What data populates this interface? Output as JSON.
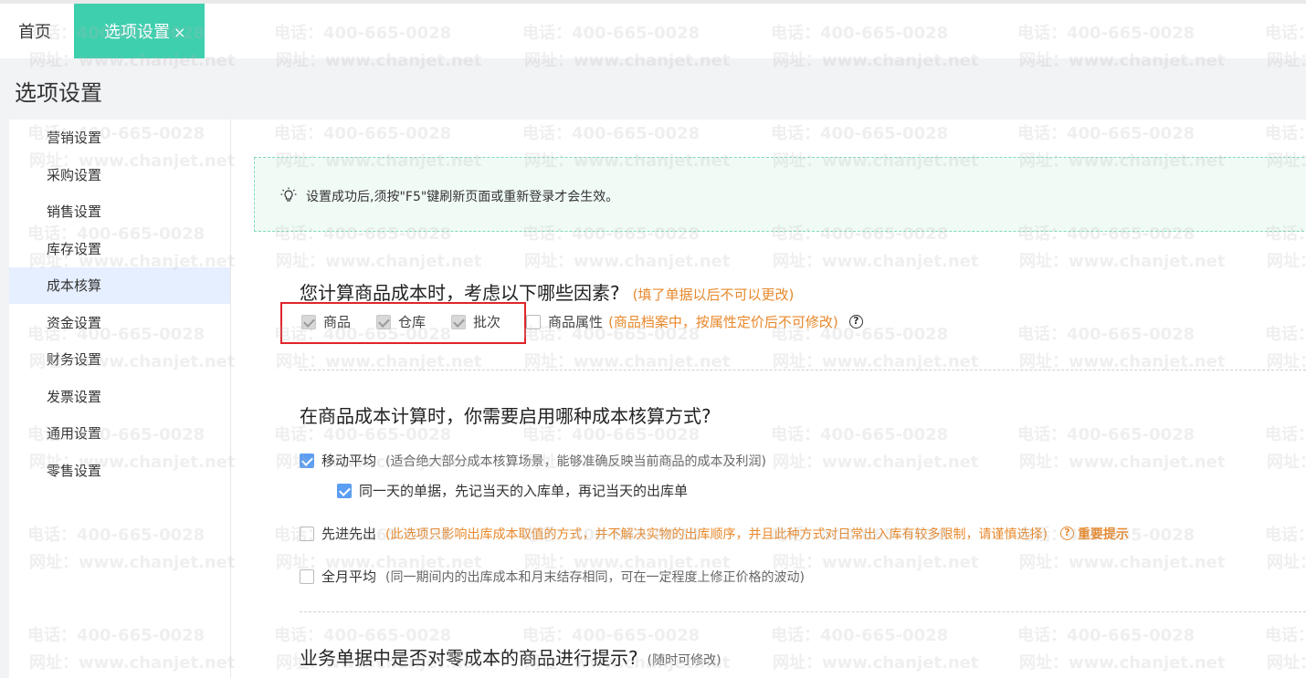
{
  "tabs": {
    "home": "首页",
    "active": "选项设置",
    "close_glyph": "×"
  },
  "header": {
    "title": "选项设置"
  },
  "sidebar": {
    "items": [
      {
        "label": "营销设置"
      },
      {
        "label": "采购设置"
      },
      {
        "label": "销售设置"
      },
      {
        "label": "库存设置"
      },
      {
        "label": "成本核算",
        "active": true
      },
      {
        "label": "资金设置"
      },
      {
        "label": "财务设置"
      },
      {
        "label": "发票设置"
      },
      {
        "label": "通用设置"
      },
      {
        "label": "零售设置"
      }
    ]
  },
  "watermark": {
    "phone": "电话：400-665-0028",
    "site": "网址：www.chanjet.net"
  },
  "tip": {
    "text": "设置成功后,须按\"F5\"键刷新页面或重新登录才会生效。"
  },
  "section1": {
    "question": "您计算商品成本时，考虑以下哪些因素?",
    "note": "(填了单据以后不可以更改)",
    "options": [
      {
        "label": "商品",
        "checked": true,
        "disabled": true
      },
      {
        "label": "仓库",
        "checked": true,
        "disabled": true
      },
      {
        "label": "批次",
        "checked": true,
        "disabled": true
      },
      {
        "label": "商品属性",
        "checked": false,
        "disabled": false
      }
    ],
    "attr_note": "(商品档案中，按属性定价后不可修改)",
    "help_glyph": "?"
  },
  "section2": {
    "question": "在商品成本计算时，你需要启用哪种成本核算方式?",
    "moving_avg": {
      "label": "移动平均",
      "checked": true,
      "hint": "(适合绝大部分成本核算场景，能够准确反映当前商品的成本及利润)"
    },
    "same_day": {
      "label": "同一天的单据，先记当天的入库单，再记当天的出库单",
      "checked": true
    },
    "fifo": {
      "label": "先进先出",
      "checked": false,
      "hint": "(此选项只影响出库成本取值的方式，并不解决实物的出库顺序，并且此种方式对日常出入库有较多限制，请谨慎选择)",
      "important": "重要提示"
    },
    "monthly_avg": {
      "label": "全月平均",
      "checked": false,
      "hint": "(同一期间内的出库成本和月末结存相同，可在一定程度上修正价格的波动)"
    }
  },
  "section3": {
    "question": "业务单据中是否对零成本的商品进行提示?",
    "note": "(随时可修改)"
  },
  "colors": {
    "tab_active": "#3ecfae",
    "checkbox": "#5b9ef3",
    "orange": "#e8882b",
    "highlight_box": "#e0242a",
    "sidebar_active": "#e6efff"
  }
}
